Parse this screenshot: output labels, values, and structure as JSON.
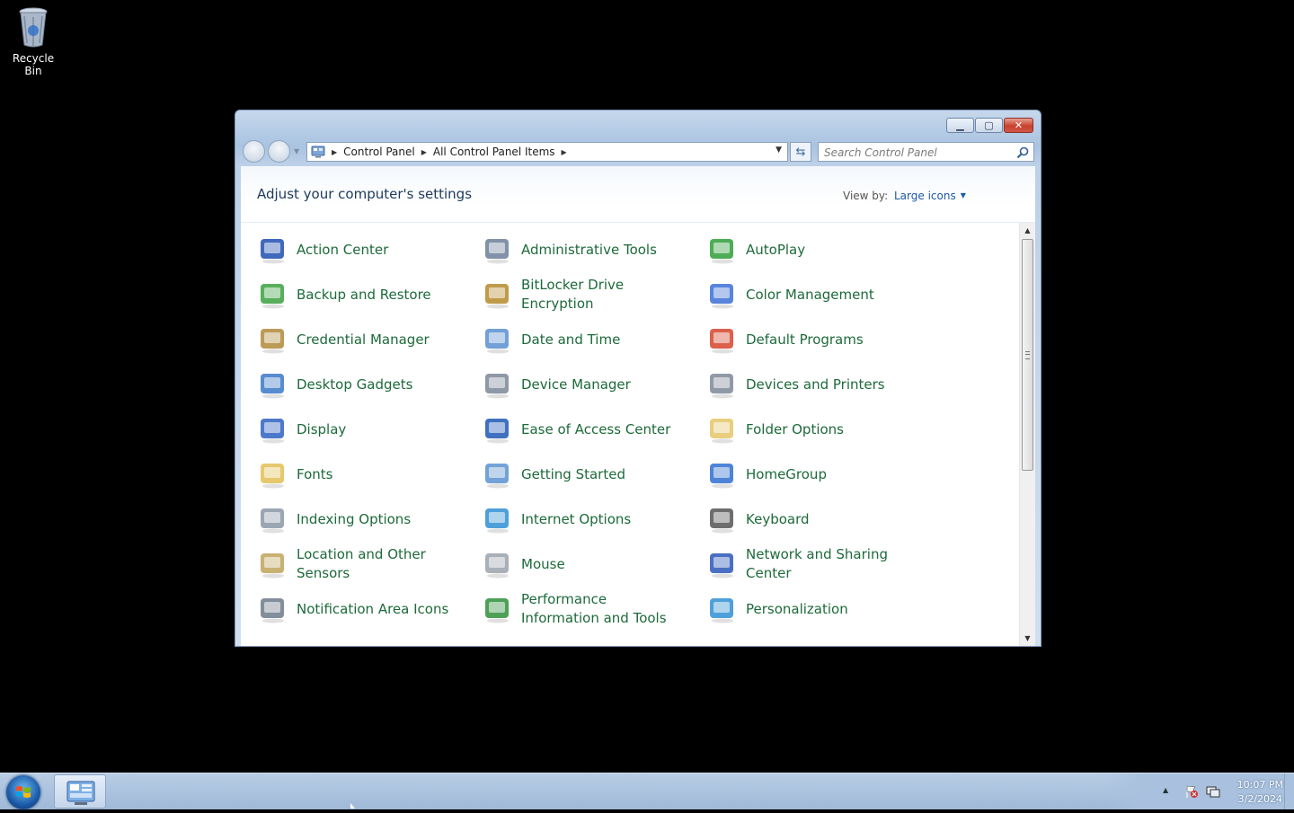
{
  "desktop": {
    "icons": [
      {
        "label": "Recycle Bin",
        "icon": "recycle-bin-icon"
      }
    ]
  },
  "window": {
    "caption_buttons": [
      "minimize",
      "maximize",
      "close"
    ],
    "address": {
      "crumbs": [
        "Control Panel",
        "All Control Panel Items"
      ]
    },
    "search": {
      "placeholder": "Search Control Panel"
    },
    "title": "Adjust your computer's settings",
    "view_by": {
      "label": "View by:",
      "value": "Large icons"
    },
    "items": [
      {
        "label": "Action Center",
        "icon": "flag-icon",
        "color": "#1f4fb0"
      },
      {
        "label": "Administrative Tools",
        "icon": "admin-tools-icon",
        "color": "#6b7f99"
      },
      {
        "label": "AutoPlay",
        "icon": "autoplay-icon",
        "color": "#2f9e3a"
      },
      {
        "label": "Backup and Restore",
        "icon": "backup-icon",
        "color": "#3aa13f"
      },
      {
        "label": "BitLocker Drive Encryption",
        "icon": "key-icon",
        "color": "#b58a2b"
      },
      {
        "label": "Color Management",
        "icon": "color-management-icon",
        "color": "#3b6fd6"
      },
      {
        "label": "Credential Manager",
        "icon": "vault-icon",
        "color": "#b08a3a"
      },
      {
        "label": "Date and Time",
        "icon": "calendar-clock-icon",
        "color": "#5b8fd0"
      },
      {
        "label": "Default Programs",
        "icon": "default-programs-icon",
        "color": "#d6452b"
      },
      {
        "label": "Desktop Gadgets",
        "icon": "gadgets-icon",
        "color": "#3a78c7"
      },
      {
        "label": "Device Manager",
        "icon": "device-manager-icon",
        "color": "#7a8696"
      },
      {
        "label": "Devices and Printers",
        "icon": "printer-icon",
        "color": "#7d8898"
      },
      {
        "label": "Display",
        "icon": "monitor-icon",
        "color": "#2d62c2"
      },
      {
        "label": "Ease of Access Center",
        "icon": "ease-of-access-icon",
        "color": "#1f58b5"
      },
      {
        "label": "Folder Options",
        "icon": "folder-icon",
        "color": "#e4c567"
      },
      {
        "label": "Fonts",
        "icon": "fonts-icon",
        "color": "#e2bf55"
      },
      {
        "label": "Getting Started",
        "icon": "getting-started-icon",
        "color": "#5b93cf"
      },
      {
        "label": "HomeGroup",
        "icon": "homegroup-icon",
        "color": "#2f6ed0"
      },
      {
        "label": "Indexing Options",
        "icon": "indexing-icon",
        "color": "#8a96a6"
      },
      {
        "label": "Internet Options",
        "icon": "internet-options-icon",
        "color": "#2f8fd4"
      },
      {
        "label": "Keyboard",
        "icon": "keyboard-icon",
        "color": "#555555"
      },
      {
        "label": "Location and Other Sensors",
        "icon": "sensors-icon",
        "color": "#c0a35a"
      },
      {
        "label": "Mouse",
        "icon": "mouse-icon",
        "color": "#9aa2ac"
      },
      {
        "label": "Network and Sharing Center",
        "icon": "network-icon",
        "color": "#2a56b8"
      },
      {
        "label": "Notification Area Icons",
        "icon": "notification-icon",
        "color": "#6d7a8a"
      },
      {
        "label": "Performance Information and Tools",
        "icon": "performance-icon",
        "color": "#2f8f3a"
      },
      {
        "label": "Personalization",
        "icon": "personalization-icon",
        "color": "#2f8fd4"
      }
    ]
  },
  "taskbar": {
    "apps": [
      {
        "icon": "control-panel-icon"
      }
    ],
    "clock": {
      "time": "10:07 PM",
      "date": "3/2/2024"
    }
  }
}
